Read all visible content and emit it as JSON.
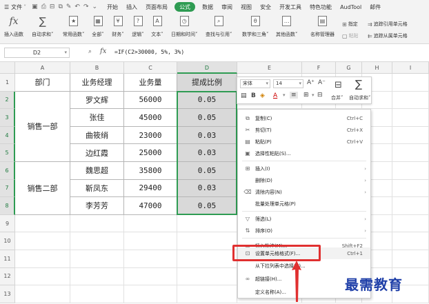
{
  "menubar": {
    "file": "文件",
    "tabs": [
      "开始",
      "插入",
      "页面布局",
      "公式",
      "数据",
      "审阅",
      "视图",
      "安全",
      "开发工具",
      "特色功能",
      "AudTool",
      "邮件"
    ],
    "active_tab": "公式"
  },
  "ribbon": {
    "insert_function": "插入函数",
    "autosum": "自动求和",
    "common_functions": "常用函数",
    "all": "全部",
    "financial": "财务",
    "logical": "逻辑",
    "text": "文本",
    "datetime": "日期和时间",
    "lookup": "查找与引用",
    "math": "数学和三角",
    "other": "其他函数",
    "name_manager": "名称管理器",
    "specify": "指定",
    "paste": "粘贴",
    "trace_precedents": "追踪引用单元格",
    "trace_dependents": "追踪从属单元格"
  },
  "formula_bar": {
    "name_box": "D2",
    "fx": "fx",
    "formula": "=IF(C2>30000, 5%, 3%)"
  },
  "sheet": {
    "columns": [
      "A",
      "B",
      "C",
      "D",
      "E",
      "F",
      "G",
      "H",
      "I"
    ],
    "rows": [
      "1",
      "2",
      "3",
      "4",
      "5",
      "6",
      "7",
      "8",
      "9",
      "10",
      "11",
      "12",
      "13"
    ],
    "headers": [
      "部门",
      "业务经理",
      "业务量",
      "提成比例"
    ],
    "groups": [
      "销售一部",
      "销售二部"
    ],
    "managers": [
      "罗文辉",
      "张佳",
      "曲筱绡",
      "边红霞",
      "魏思超",
      "靳凤东",
      "李芳芳"
    ],
    "volumes": [
      "56000",
      "45000",
      "23000",
      "25000",
      "35800",
      "29400",
      "47000"
    ],
    "rates": [
      "0.05",
      "0.05",
      "0.03",
      "0.03",
      "0.05",
      "0.03",
      "0.05"
    ]
  },
  "mini_toolbar": {
    "font": "宋体",
    "size": "14",
    "grow": "A⁺",
    "shrink": "A⁻",
    "merge": "合并",
    "autosum": "自动求和"
  },
  "context_menu": {
    "copy": {
      "label": "复制(C)",
      "shortcut": "Ctrl+C"
    },
    "cut": {
      "label": "剪切(T)",
      "shortcut": "Ctrl+X"
    },
    "paste": {
      "label": "粘贴(P)",
      "shortcut": "Ctrl+V"
    },
    "paste_special": {
      "label": "选择性粘贴(S)..."
    },
    "insert": {
      "label": "插入(I)"
    },
    "delete": {
      "label": "删除(D)"
    },
    "clear": {
      "label": "清除内容(N)"
    },
    "batch": {
      "label": "批量处理单元格(P)"
    },
    "filter": {
      "label": "筛选(L)"
    },
    "sort": {
      "label": "排序(O)"
    },
    "comment": {
      "label": "插入批注(M)...",
      "shortcut": "Shift+F2"
    },
    "format_cells": {
      "label": "设置单元格格式(F)...",
      "shortcut": "Ctrl+1"
    },
    "pick_list": {
      "label": "从下拉列表中选择(K)..."
    },
    "hyperlink": {
      "label": "超链接(H)..."
    },
    "define_name": {
      "label": "定义名称(A)..."
    }
  },
  "watermark": "最需教育",
  "colors": {
    "accent": "#2e9b52",
    "highlight_box": "#e03030",
    "watermark": "#1f3fa8"
  }
}
